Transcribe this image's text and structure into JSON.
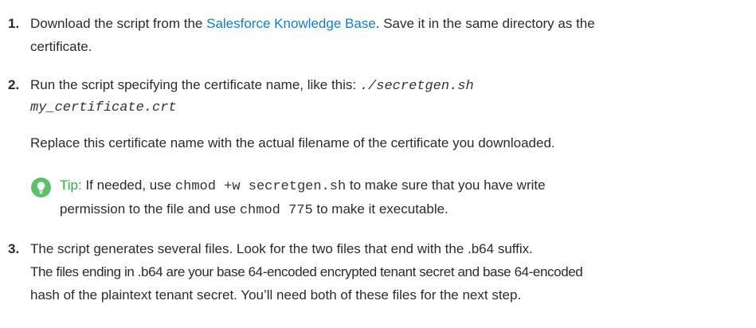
{
  "steps": [
    {
      "number": "1.",
      "text_before_link": "Download the script from the ",
      "link": "Salesforce Knowledge Base",
      "text_after_link": ". Save it in the same directory as the",
      "line2": "certificate."
    },
    {
      "number": "2.",
      "text": "Run the script specifying the certificate name, like this: ",
      "code_part1": "./secretgen.sh",
      "code_part2": "my_certificate.crt",
      "note": "Replace this certificate name with the actual filename of the certificate you downloaded.",
      "tip": {
        "label": "Tip:",
        "text1": " If needed, use ",
        "code1": "chmod +w secretgen.sh",
        "text2": " to make sure that you have write",
        "text3": "permission to the file and use ",
        "code2": "chmod 775",
        "text4": " to make it executable."
      }
    },
    {
      "number": "3.",
      "line1": "The script generates several files. Look for the two files that end with the .b64 suffix.",
      "line2": "The files ending in .b64 are your base 64-encoded encrypted tenant secret and base 64-encoded",
      "line3": "hash of the plaintext tenant secret. You’ll need both of these files for the next step."
    }
  ],
  "colors": {
    "text": "#2b2b2b",
    "link": "#1a7bc4",
    "tip": "#37a94a",
    "tip_icon": "#5bc06a"
  },
  "icons": {
    "tip": "lightbulb-icon"
  }
}
